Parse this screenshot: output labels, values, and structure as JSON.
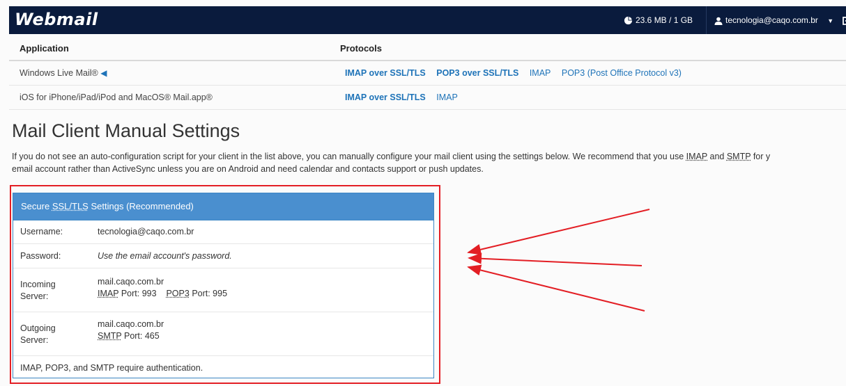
{
  "topbar": {
    "logo": "Webmail",
    "quota": "23.6 MB / 1 GB",
    "user": "tecnologia@caqo.com.br",
    "icons": [
      "pie-chart-icon",
      "user-icon",
      "caret-down-icon",
      "logout-icon"
    ]
  },
  "table": {
    "headers": [
      "Application",
      "Protocols"
    ],
    "rows": [
      {
        "app": "Windows Live Mail®",
        "protocols": [
          "IMAP over SSL/TLS",
          "POP3 over SSL/TLS",
          "IMAP",
          "POP3 (Post Office Protocol v3)"
        ]
      },
      {
        "app": "iOS for iPhone/iPad/iPod and MacOS® Mail.app®",
        "protocols": [
          "IMAP over SSL/TLS",
          "IMAP"
        ]
      }
    ]
  },
  "manual": {
    "title": "Mail Client Manual Settings",
    "intro_1": "If you do not see an auto-configuration script for your client in the list above, you can manually configure your mail client using the settings below. We recommend that you use",
    "intro_imap": "IMAP",
    "intro_and": "and",
    "intro_smtp": "SMTP",
    "intro_2": "for y",
    "intro_line2": "email account rather than ActiveSync unless you are on Android and need calendar and contacts support or push updates."
  },
  "panel": {
    "heading_prefix": "Secure",
    "heading_abbr": "SSL/TLS",
    "heading_suffix": "Settings (Recommended)",
    "username_label": "Username:",
    "username_value": "tecnologia@caqo.com.br",
    "password_label": "Password:",
    "password_value": "Use the email account's password.",
    "incoming_label_1": "Incoming",
    "incoming_label_2": "Server:",
    "incoming_host": "mail.caqo.com.br",
    "incoming_imap": "IMAP",
    "incoming_imap_port": "Port: 993",
    "incoming_pop3": "POP3",
    "incoming_pop3_port": "Port: 995",
    "outgoing_label_1": "Outgoing",
    "outgoing_label_2": "Server:",
    "outgoing_host": "mail.caqo.com.br",
    "outgoing_smtp": "SMTP",
    "outgoing_smtp_port": "Port: 465",
    "footer": "IMAP, POP3, and SMTP require authentication."
  },
  "colors": {
    "topbar": "#0a1b3d",
    "link": "#1e73b8",
    "panel_head": "#4a8fcf",
    "annotation": "#e31e24"
  }
}
